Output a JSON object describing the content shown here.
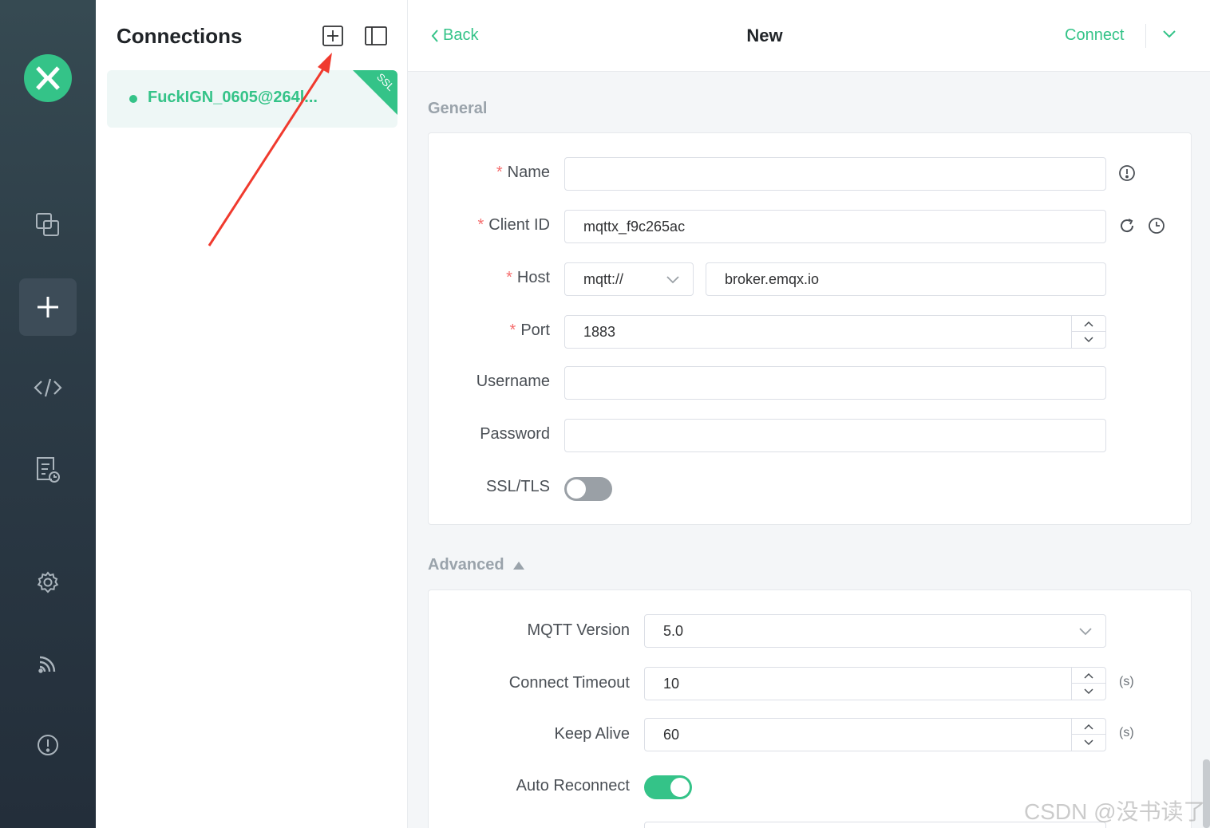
{
  "connections_panel": {
    "title": "Connections",
    "connection_item": {
      "name": "FuckIGN_0605@264l...",
      "badge": "SSL"
    }
  },
  "topbar": {
    "back_label": "Back",
    "title": "New",
    "connect_label": "Connect"
  },
  "general": {
    "section_title": "General",
    "name": {
      "label": "Name",
      "value": ""
    },
    "client_id": {
      "label": "Client ID",
      "value": "mqttx_f9c265ac"
    },
    "host": {
      "label": "Host",
      "protocol": "mqtt://",
      "value": "broker.emqx.io"
    },
    "port": {
      "label": "Port",
      "value": "1883"
    },
    "username": {
      "label": "Username",
      "value": ""
    },
    "password": {
      "label": "Password",
      "value": ""
    },
    "ssl_tls": {
      "label": "SSL/TLS",
      "enabled": false
    }
  },
  "advanced": {
    "section_title": "Advanced",
    "mqtt_version": {
      "label": "MQTT Version",
      "value": "5.0"
    },
    "connect_timeout": {
      "label": "Connect Timeout",
      "value": "10",
      "unit": "(s)"
    },
    "keep_alive": {
      "label": "Keep Alive",
      "value": "60",
      "unit": "(s)"
    },
    "auto_reconnect": {
      "label": "Auto Reconnect",
      "enabled": true
    }
  },
  "watermark": "CSDN @没书读了",
  "colors": {
    "accent": "#34c388",
    "rail_top": "#364a52",
    "rail_bottom": "#232e3a",
    "annotation_arrow": "#f03a2e"
  },
  "icons": {
    "rail": [
      "mqttx-logo-icon",
      "connections-icon",
      "new-connection-plus-icon",
      "script-code-icon",
      "log-icon",
      "settings-gear-icon",
      "subscription-feed-icon",
      "about-info-icon"
    ],
    "panel": [
      "new-connection-icon",
      "toggle-sidebar-icon"
    ]
  }
}
